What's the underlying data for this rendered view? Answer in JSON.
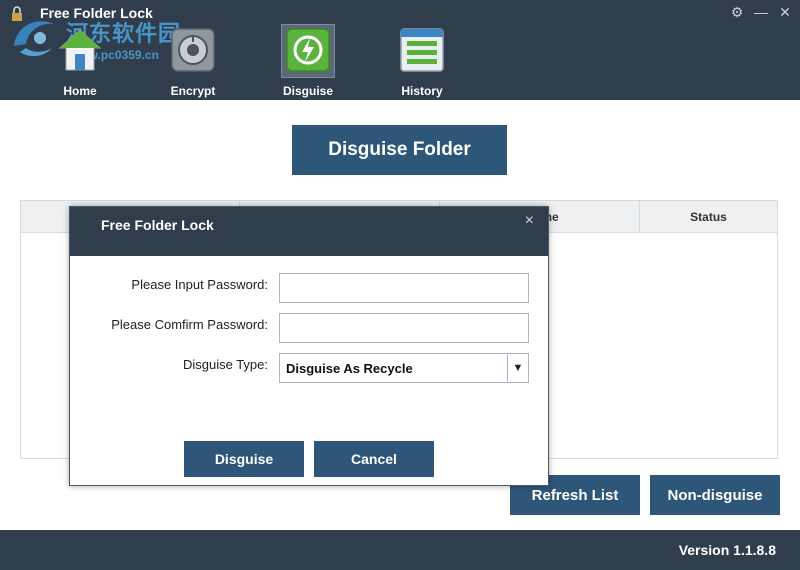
{
  "app": {
    "title": "Free Folder Lock",
    "watermark_text": "河东软件园",
    "watermark_url": "www.pc0359.cn",
    "version": "Version 1.1.8.8"
  },
  "colors": {
    "header_bg": "#2f3d4d",
    "button_bg": "#2d5679",
    "accent_green": "#5bb33d"
  },
  "nav": {
    "items": [
      {
        "label": "Home",
        "icon": "house-icon"
      },
      {
        "label": "Encrypt",
        "icon": "vault-icon"
      },
      {
        "label": "Disguise",
        "icon": "recycle-shield-icon",
        "active": true
      },
      {
        "label": "History",
        "icon": "list-icon"
      }
    ]
  },
  "main": {
    "primary_button": "Disguise Folder",
    "table": {
      "columns": [
        "",
        "",
        "d Time",
        "Status"
      ]
    },
    "refresh_button": "Refresh List",
    "nondisguise_button": "Non-disguise"
  },
  "dialog": {
    "title": "Free Folder Lock",
    "close_glyph": "×",
    "password_label": "Please Input Password:",
    "password_value": "",
    "confirm_label": "Please Comfirm Password:",
    "confirm_value": "",
    "type_label": "Disguise Type:",
    "type_value": "Disguise As Recycle",
    "arrow_glyph": "▼",
    "disguise_button": "Disguise",
    "cancel_button": "Cancel"
  },
  "window_controls": {
    "settings_glyph": "⚙",
    "minimize_glyph": "—",
    "close_glyph": "✕"
  }
}
